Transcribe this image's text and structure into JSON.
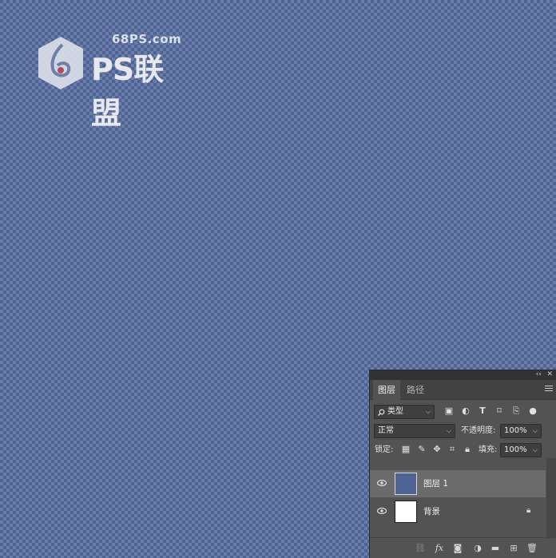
{
  "watermark": {
    "domain": "68PS.com",
    "brand": "PS联盟",
    "logo": "ps-league-logo"
  },
  "canvas": {
    "background": "transparency-checkerboard",
    "tile_colors": [
      "#4e6394",
      "#6b7ea9"
    ]
  },
  "panel": {
    "collapse_glyph": "‹‹",
    "close_glyph": "✕",
    "tabs": [
      {
        "label": "图层",
        "active": true
      },
      {
        "label": "路径",
        "active": false
      }
    ],
    "filter": {
      "label": "类型",
      "icons": [
        "image-filter-icon",
        "adjustment-filter-icon",
        "type-filter-icon",
        "shape-filter-icon",
        "smart-object-filter-icon",
        "filter-toggle-icon"
      ]
    },
    "blend_mode": "正常",
    "opacity_label": "不透明度:",
    "opacity_value": "100%",
    "lock_label": "锁定:",
    "fill_label": "填充:",
    "fill_value": "100%",
    "layers": [
      {
        "name": "图层 1",
        "selected": true,
        "visible": true,
        "thumb_color": "#4e6394",
        "locked": false
      },
      {
        "name": "背景",
        "selected": false,
        "visible": true,
        "thumb_color": "#ffffff",
        "locked": true
      }
    ],
    "bottom_icons": [
      "link-layers-icon",
      "fx-icon",
      "add-mask-icon",
      "adjustment-layer-icon",
      "new-group-icon",
      "new-layer-icon",
      "delete-layer-icon"
    ]
  }
}
